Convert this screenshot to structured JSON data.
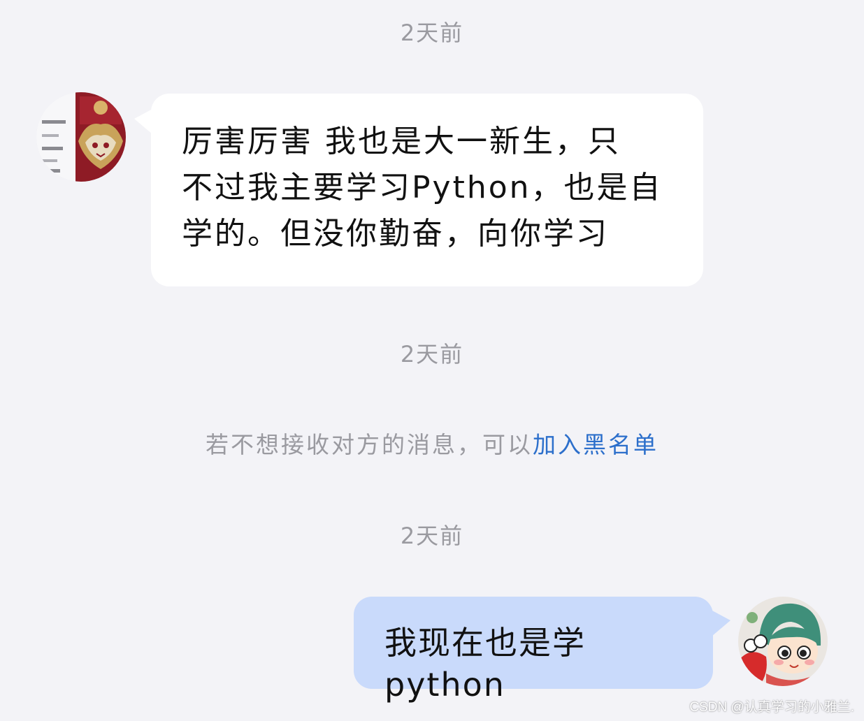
{
  "messages": [
    {
      "timestamp": "2天前",
      "sender": "other",
      "avatar_icon": "dragon-avatar-icon",
      "lines": [
        "厉害厉害 我也是大一新生，只",
        "不过我主要学习Python，也是自",
        "学的。但没你勤奋，向你学习"
      ]
    }
  ],
  "second_timestamp": "2天前",
  "notice": {
    "text": "若不想接收对方的消息，可以",
    "link": "加入黑名单"
  },
  "third_timestamp": "2天前",
  "reply": {
    "sender": "self",
    "avatar_icon": "cartoon-girl-avatar-icon",
    "text": "我现在也是学python"
  },
  "watermark": "CSDN @认真学习的小雅兰.",
  "colors": {
    "background": "#f3f3f7",
    "incoming_bubble": "#ffffff",
    "outgoing_bubble": "#c9dafb",
    "link": "#2c6fcb",
    "muted_text": "#9a9aa0"
  }
}
